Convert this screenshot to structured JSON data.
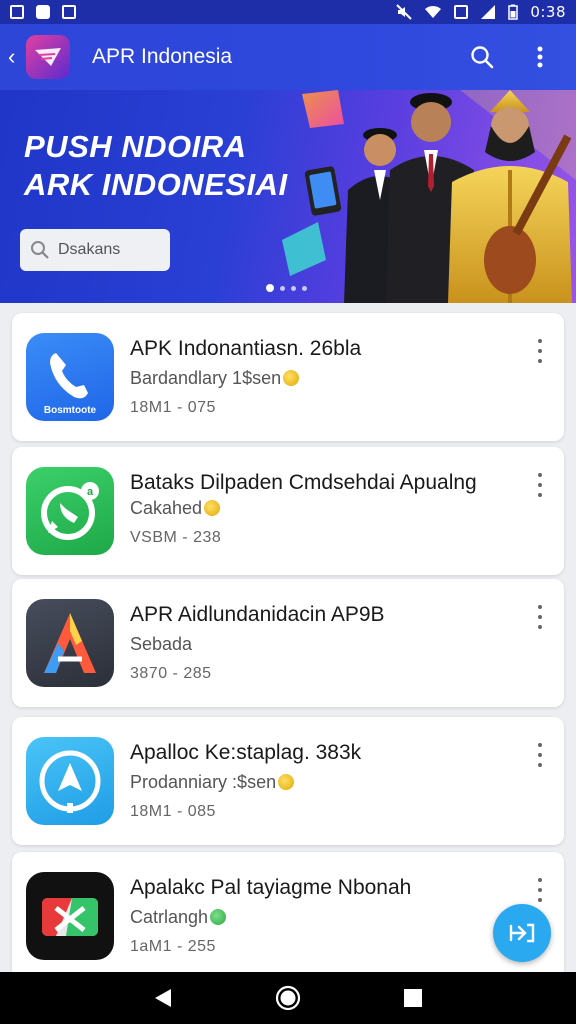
{
  "status_bar": {
    "time": "0:38"
  },
  "app_bar": {
    "title": "APR Indonesia",
    "back_icon": "back-arrow-icon",
    "search_icon": "search-icon",
    "more_icon": "more-vert-icon"
  },
  "banner": {
    "title_line1": "PUSH NDOIRA",
    "title_line2": "ARK INDONESIAI",
    "search_placeholder": "Dsakans",
    "dots_count": 4,
    "active_dot": 0
  },
  "apps": [
    {
      "title": "APK  Indonantiasn. 26bla",
      "subtitle": "Bardandlary 1$sen",
      "badge": "coin-gold",
      "meta": "18M1 - 075",
      "icon": "phone-icon",
      "icon_label": "Bosmtoote",
      "icon_color": "#2f7bf2"
    },
    {
      "title": "Bataks Dilpaden Cmdsehdai Apualng",
      "subtitle": "Cakahed",
      "badge": "coin-gold",
      "meta": "VSBM - 238",
      "icon": "whatsapp-icon",
      "icon_color": "#2ec05a"
    },
    {
      "title": "APR Aidlundanidacin AP9B",
      "subtitle": "Sebada",
      "badge": "",
      "meta": "3870 - 285",
      "icon": "a-logo-icon",
      "icon_color": "#3a3f4a"
    },
    {
      "title": "Apalloc Ke:staplag. 383k",
      "subtitle": "Prodanniary :$sen",
      "badge": "coin-gold",
      "meta": "18M1 - 085",
      "icon": "navigation-icon",
      "icon_color": "#2ab3f0"
    },
    {
      "title": "Apalakc Pal tayiagme Nbonah",
      "subtitle": "Catrlangh",
      "badge": "coin-green",
      "meta": "1aM1 - 255",
      "icon": "video-edit-icon",
      "icon_color": "#111111"
    }
  ],
  "fab": {
    "icon": "share-icon"
  },
  "nav": {
    "back": "nav-back-icon",
    "home": "nav-home-icon",
    "recents": "nav-recents-icon"
  }
}
